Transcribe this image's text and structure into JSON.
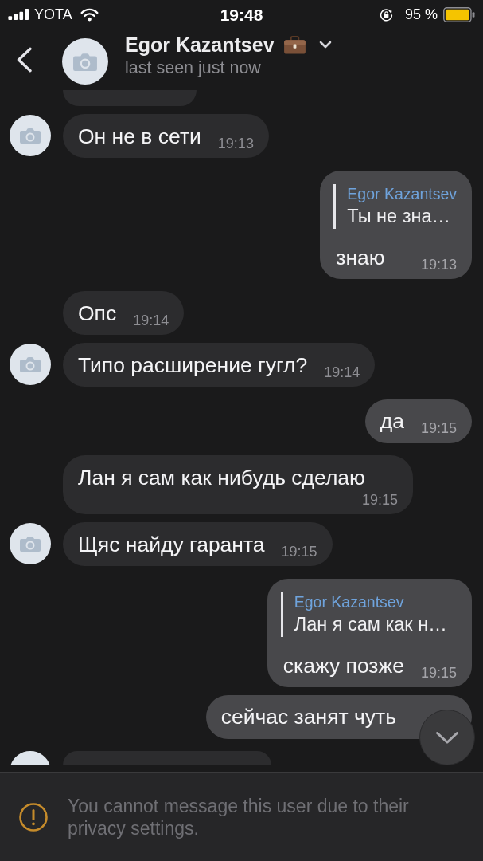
{
  "status_bar": {
    "carrier": "YOTA",
    "time": "19:48",
    "battery": "95 %"
  },
  "header": {
    "name": "Egor Kazantsev",
    "status": "last seen just now"
  },
  "messages": [
    {
      "kind": "cut",
      "outgoing": false
    },
    {
      "kind": "text",
      "outgoing": false,
      "text": "Он не в сети",
      "time": "19:13"
    },
    {
      "kind": "reply",
      "outgoing": true,
      "reply_to": {
        "name": "Egor Kazantsev",
        "text": "Ты не зна…"
      },
      "text": "знаю",
      "time": "19:13"
    },
    {
      "kind": "text",
      "outgoing": false,
      "text": "Опс",
      "time": "19:14"
    },
    {
      "kind": "text",
      "outgoing": false,
      "text": "Типо расширение гугл?",
      "time": "19:14"
    },
    {
      "kind": "text",
      "outgoing": true,
      "text": "да",
      "time": "19:15"
    },
    {
      "kind": "text",
      "outgoing": false,
      "text": "Лан я сам как нибудь сделаю",
      "time": "19:15"
    },
    {
      "kind": "text",
      "outgoing": false,
      "text": "Щяс найду гаранта",
      "time": "19:15"
    },
    {
      "kind": "reply",
      "outgoing": true,
      "reply_to": {
        "name": "Egor Kazantsev",
        "text": "Лан я сам как н…"
      },
      "text": "скажу позже",
      "time": "19:15"
    },
    {
      "kind": "text",
      "outgoing": true,
      "text": "сейчас занят чуть"
    },
    {
      "kind": "cut",
      "outgoing": false
    }
  ],
  "notice": {
    "text": "You cannot message this user due to their privacy settings."
  }
}
